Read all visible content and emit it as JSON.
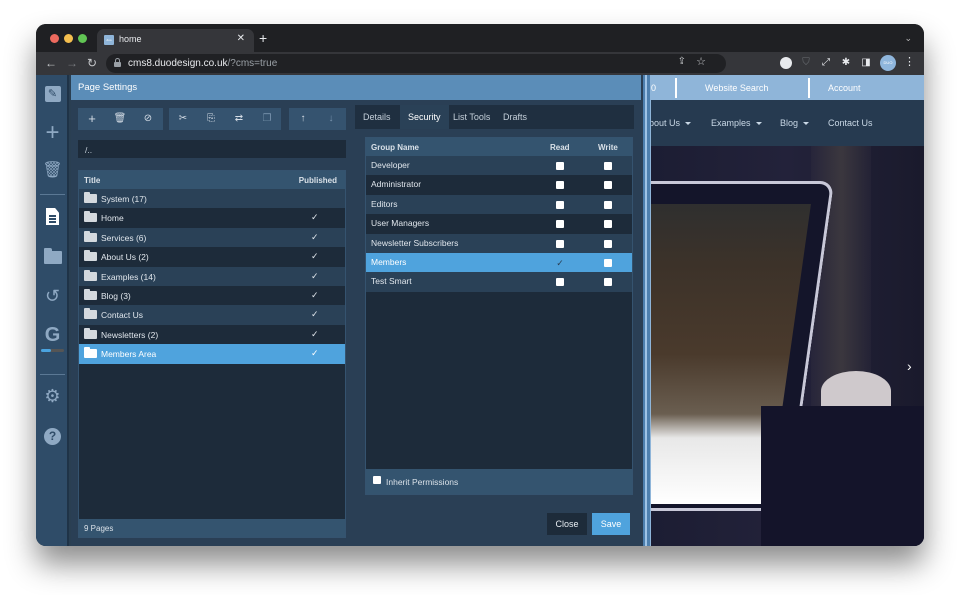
{
  "browser": {
    "tab_title": "home",
    "tab_favicon": "duo",
    "url_host": "cms8.duodesign.co.uk",
    "url_rest": "/?cms=true",
    "avatar_label": "DUO",
    "icons": {
      "back": "arrow-left-icon",
      "forward": "arrow-right-icon",
      "reload": "reload-icon",
      "share": "share-icon",
      "bookmark": "star-icon",
      "extensions": [
        "circle-extension-icon",
        "shield-extension-icon",
        "expand-icon",
        "puzzle-icon",
        "sidepanel-icon"
      ],
      "menu": "kebab-menu-icon"
    }
  },
  "cms_sidebar": {
    "items": [
      {
        "name": "edit",
        "icon": "pencil-icon"
      },
      {
        "name": "add",
        "icon": "plus-icon"
      },
      {
        "name": "delete",
        "icon": "trash-icon"
      },
      {
        "name": "pages",
        "icon": "document-icon",
        "active": true
      },
      {
        "name": "files",
        "icon": "folder-icon"
      },
      {
        "name": "history",
        "icon": "history-icon"
      },
      {
        "name": "google",
        "icon": "google-g-icon",
        "progress": 0.45
      },
      {
        "name": "settings",
        "icon": "gear-icon"
      },
      {
        "name": "help",
        "icon": "help-icon"
      }
    ]
  },
  "dialog": {
    "title": "Page Settings",
    "toolbar": {
      "add": "+",
      "delete": "🗑",
      "hide": "⊘",
      "cut": "✂",
      "copy": "⎘",
      "swap": "⇄",
      "paste": "❐",
      "up": "↑",
      "down": "↓"
    },
    "path": "/..",
    "pages_table": {
      "columns": [
        "Title",
        "Published"
      ],
      "rows": [
        {
          "title": "System (17)",
          "published": ""
        },
        {
          "title": "Home",
          "published": "✓"
        },
        {
          "title": "Services (6)",
          "published": "✓"
        },
        {
          "title": "About Us (2)",
          "published": "✓"
        },
        {
          "title": "Examples (14)",
          "published": "✓"
        },
        {
          "title": "Blog (3)",
          "published": "✓"
        },
        {
          "title": "Contact Us",
          "published": "✓"
        },
        {
          "title": "Newsletters (2)",
          "published": "✓"
        },
        {
          "title": "Members Area",
          "published": "✓",
          "selected": true
        }
      ],
      "footer": "9 Pages"
    },
    "tabs": [
      "Details",
      "Security",
      "List Tools",
      "Drafts"
    ],
    "active_tab": "Security",
    "permissions": {
      "columns": [
        "Group Name",
        "Read",
        "Write"
      ],
      "rows": [
        {
          "group": "Developer",
          "read": false,
          "write": false
        },
        {
          "group": "Administrator",
          "read": false,
          "write": false
        },
        {
          "group": "Editors",
          "read": false,
          "write": false
        },
        {
          "group": "User Managers",
          "read": false,
          "write": false
        },
        {
          "group": "Newsletter Subscribers",
          "read": false,
          "write": false
        },
        {
          "group": "Members",
          "read": true,
          "write": false,
          "selected": true
        },
        {
          "group": "Test Smart",
          "read": false,
          "write": false
        }
      ],
      "inherit_label": "Inherit Permissions",
      "inherit_checked": false
    },
    "buttons": {
      "close": "Close",
      "save": "Save"
    }
  },
  "website": {
    "topbar": [
      "0",
      "Website Search",
      "Account"
    ],
    "nav": [
      {
        "label": "bout Us",
        "dropdown": true
      },
      {
        "label": "Examples",
        "dropdown": true
      },
      {
        "label": "Blog",
        "dropdown": true
      },
      {
        "label": "Contact Us",
        "dropdown": false
      }
    ],
    "slider_next": "›"
  },
  "colors": {
    "accent": "#4fa3dd",
    "header": "#5b8db8",
    "panel": "#2a3f55",
    "sidebar": "#2f4c68"
  }
}
